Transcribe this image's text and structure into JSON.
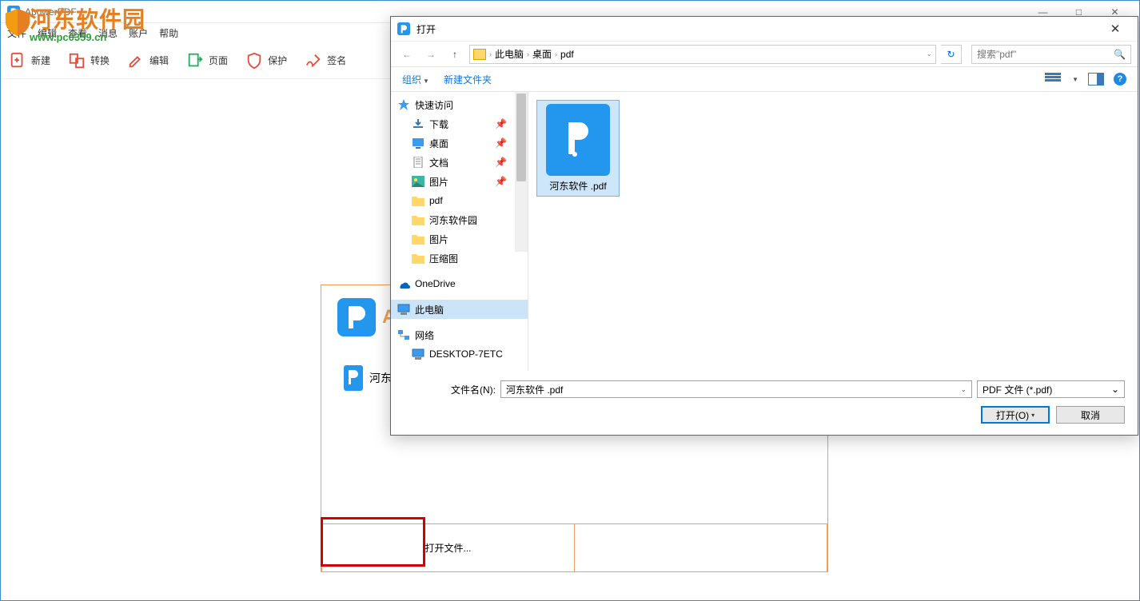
{
  "colors": {
    "accent": "#f0a050",
    "blue": "#2396ed",
    "link": "#1976d2",
    "red": "#d40000",
    "green": "#2e9e3a"
  },
  "app": {
    "title": "ApowerPDF",
    "menu": [
      "文件",
      "编辑",
      "查看",
      "消息",
      "账户",
      "帮助"
    ],
    "toolbar": [
      {
        "icon": "new-file-icon",
        "label": "新建"
      },
      {
        "icon": "convert-icon",
        "label": "转换"
      },
      {
        "icon": "edit-icon",
        "label": "编辑"
      },
      {
        "icon": "page-icon",
        "label": "页面"
      },
      {
        "icon": "protect-icon",
        "label": "保护"
      },
      {
        "icon": "sign-icon",
        "label": "签名"
      }
    ]
  },
  "watermark": {
    "text": "河东软件园",
    "url": "www.pc0359.cn"
  },
  "welcome": {
    "logo_letter": "A",
    "recent_label": "河东",
    "open_label": "打开文件..."
  },
  "dialog": {
    "title": "打开",
    "breadcrumb": [
      "此电脑",
      "桌面",
      "pdf"
    ],
    "search_placeholder": "搜索\"pdf\"",
    "organize": "组织",
    "new_folder": "新建文件夹",
    "tree": [
      {
        "icon": "star",
        "label": "快速访问"
      },
      {
        "icon": "download",
        "label": "下载",
        "pinned": true,
        "indent": true
      },
      {
        "icon": "desktop",
        "label": "桌面",
        "pinned": true,
        "indent": true
      },
      {
        "icon": "doc",
        "label": "文档",
        "pinned": true,
        "indent": true
      },
      {
        "icon": "pic",
        "label": "图片",
        "pinned": true,
        "indent": true
      },
      {
        "icon": "folder",
        "label": "pdf",
        "indent": true
      },
      {
        "icon": "folder",
        "label": "河东软件园",
        "indent": true
      },
      {
        "icon": "folder",
        "label": "图片",
        "indent": true
      },
      {
        "icon": "folder",
        "label": "压缩图",
        "indent": true
      },
      {
        "icon": "onedrive",
        "label": "OneDrive"
      },
      {
        "icon": "pc",
        "label": "此电脑",
        "selected": true
      },
      {
        "icon": "network",
        "label": "网络"
      },
      {
        "icon": "pc",
        "label": "DESKTOP-7ETC",
        "indent": true
      }
    ],
    "file": {
      "name": "河东软件 .pdf"
    },
    "filename_label": "文件名(N):",
    "filename_value": "河东软件 .pdf",
    "filter": "PDF 文件 (*.pdf)",
    "open_btn": "打开(O)",
    "cancel_btn": "取消"
  }
}
